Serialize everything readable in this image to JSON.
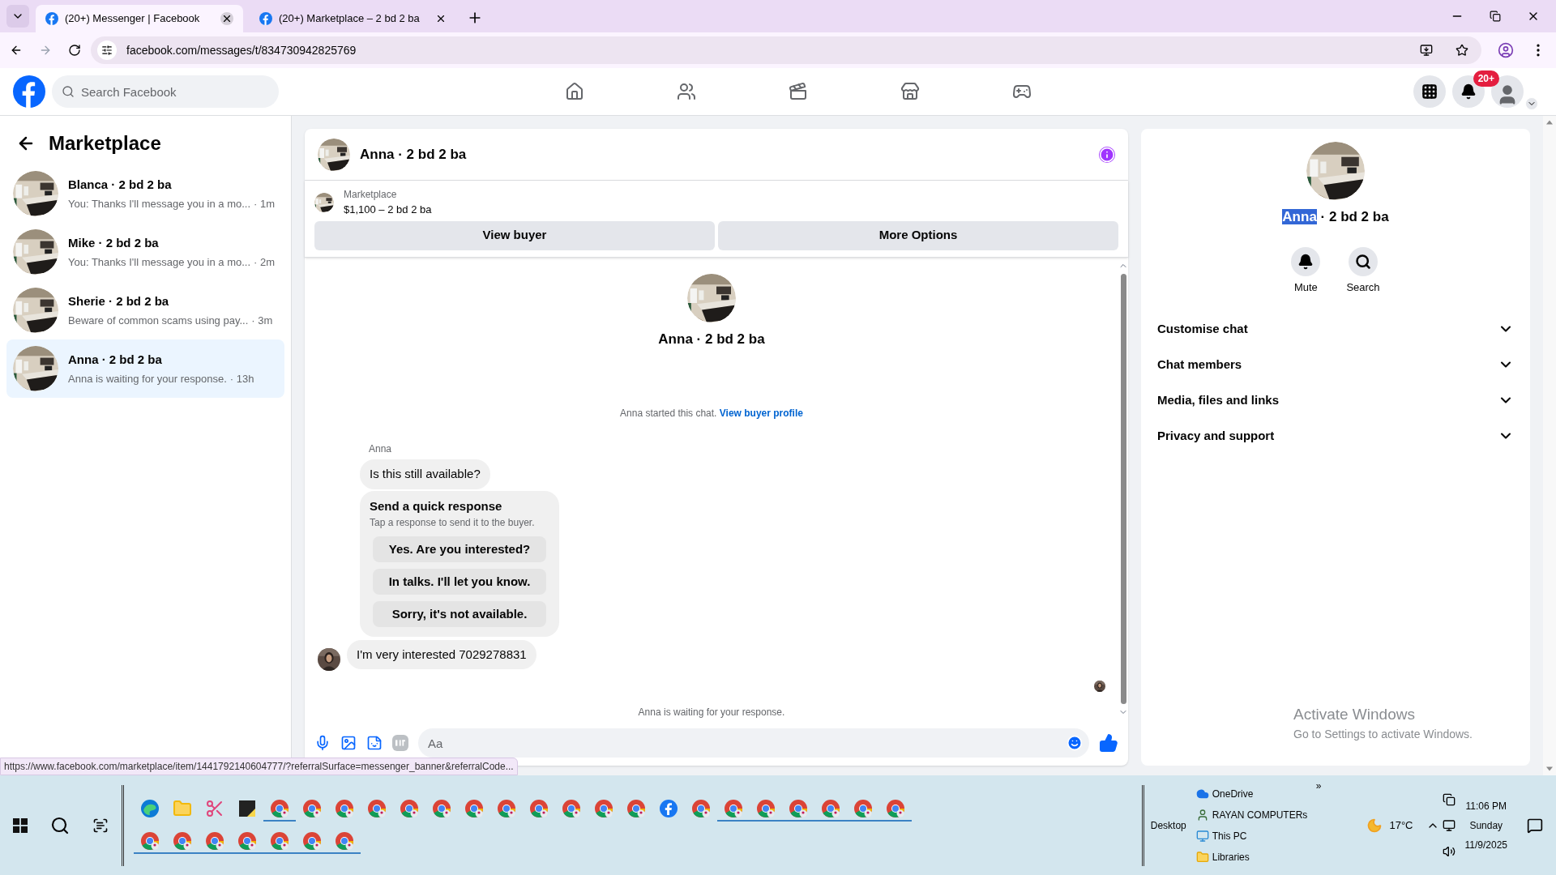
{
  "browser": {
    "tabs": [
      {
        "title": "(20+) Messenger | Facebook",
        "selected": true
      },
      {
        "title": "(20+) Marketplace – 2 bd 2 ba",
        "selected": false
      }
    ],
    "url": "facebook.com/messages/t/834730942825769",
    "status_url": "https://www.facebook.com/marketplace/item/1441792140604777/?referralSurface=messenger_banner&referralCode..."
  },
  "topbar": {
    "search_placeholder": "Search Facebook",
    "notification_badge": "20+"
  },
  "sidebar": {
    "title": "Marketplace",
    "chats": [
      {
        "name": "Blanca · 2 bd 2 ba",
        "preview": "You: Thanks I'll message you in a mo...",
        "time": "· 1m",
        "selected": false
      },
      {
        "name": "Mike · 2 bd 2 ba",
        "preview": "You: Thanks I'll message you in a mo...",
        "time": "· 2m",
        "selected": false
      },
      {
        "name": "Sherie · 2 bd 2 ba",
        "preview": "Beware of common scams using pay...",
        "time": "· 3m",
        "selected": false
      },
      {
        "name": "Anna · 2 bd 2 ba",
        "preview": "Anna is waiting for your response.",
        "time": "· 13h",
        "selected": true
      }
    ]
  },
  "chat": {
    "title": "Anna · 2 bd 2 ba",
    "listing_label": "Marketplace",
    "listing": "$1,100 – 2 bd 2 ba",
    "buttons": [
      "View buyer",
      "More Options"
    ],
    "profile_name": "Anna · 2 bd 2 ba",
    "started_text": "Anna started this chat.",
    "started_link": "View buyer profile",
    "sender": "Anna",
    "first_message": "Is this still available?",
    "quick": {
      "title": "Send a quick response",
      "subtitle": "Tap a response to send it to the buyer.",
      "options": [
        "Yes. Are you interested?",
        "In talks. I'll let you know.",
        "Sorry, it's not available."
      ]
    },
    "last_message": "I'm very interested 7029278831",
    "waiting": "Anna is waiting for your response.",
    "composer_placeholder": "Aa"
  },
  "details": {
    "name_highlighted": "Anna",
    "name_rest": " · 2 bd 2 ba",
    "actions": [
      {
        "label": "Mute",
        "kind": "mute"
      },
      {
        "label": "Search",
        "kind": "search"
      }
    ],
    "sections": [
      "Customise chat",
      "Chat members",
      "Media, files and links",
      "Privacy and support"
    ]
  },
  "activation": {
    "title": "Activate Windows",
    "text": "Go to Settings to activate Windows."
  },
  "taskbar": {
    "apps_row_1": [
      {
        "kind": "edge",
        "running": false
      },
      {
        "kind": "folder",
        "running": false
      },
      {
        "kind": "snip",
        "running": false
      },
      {
        "kind": "sticky",
        "running": false
      },
      {
        "kind": "chrome",
        "running": true
      },
      {
        "kind": "chrome",
        "running": false
      },
      {
        "kind": "chrome",
        "running": false
      },
      {
        "kind": "chrome",
        "running": false
      },
      {
        "kind": "chrome",
        "running": false
      },
      {
        "kind": "chrome",
        "running": false
      },
      {
        "kind": "chrome",
        "running": false
      },
      {
        "kind": "chrome",
        "running": false
      },
      {
        "kind": "chrome",
        "running": false
      },
      {
        "kind": "chrome",
        "running": false
      },
      {
        "kind": "chrome",
        "running": false
      },
      {
        "kind": "chrome",
        "running": false
      },
      {
        "kind": "facebook",
        "running": false
      },
      {
        "kind": "chrome",
        "running": false
      },
      {
        "kind": "chrome",
        "running": true
      },
      {
        "kind": "chrome",
        "running": true
      },
      {
        "kind": "chrome",
        "running": true
      },
      {
        "kind": "chrome",
        "running": true
      },
      {
        "kind": "chrome",
        "running": true
      },
      {
        "kind": "chrome",
        "running": true
      }
    ],
    "apps_row_2": [
      {
        "kind": "chrome",
        "running": true
      },
      {
        "kind": "chrome",
        "running": true
      },
      {
        "kind": "chrome",
        "running": true
      },
      {
        "kind": "chrome",
        "running": true
      },
      {
        "kind": "chrome",
        "running": true
      },
      {
        "kind": "chrome",
        "running": true
      },
      {
        "kind": "chrome",
        "running": true
      }
    ],
    "desktop_label": "Desktop",
    "more": "»",
    "toolbar_items": [
      {
        "label": "OneDrive",
        "kind": "cloud"
      },
      {
        "label": "RAYAN COMPUTERs",
        "kind": "user"
      },
      {
        "label": "This PC",
        "kind": "pc"
      },
      {
        "label": "Libraries",
        "kind": "folder"
      }
    ],
    "temperature": "17°C",
    "time": "11:06 PM",
    "day": "Sunday",
    "date": "11/9/2025"
  }
}
